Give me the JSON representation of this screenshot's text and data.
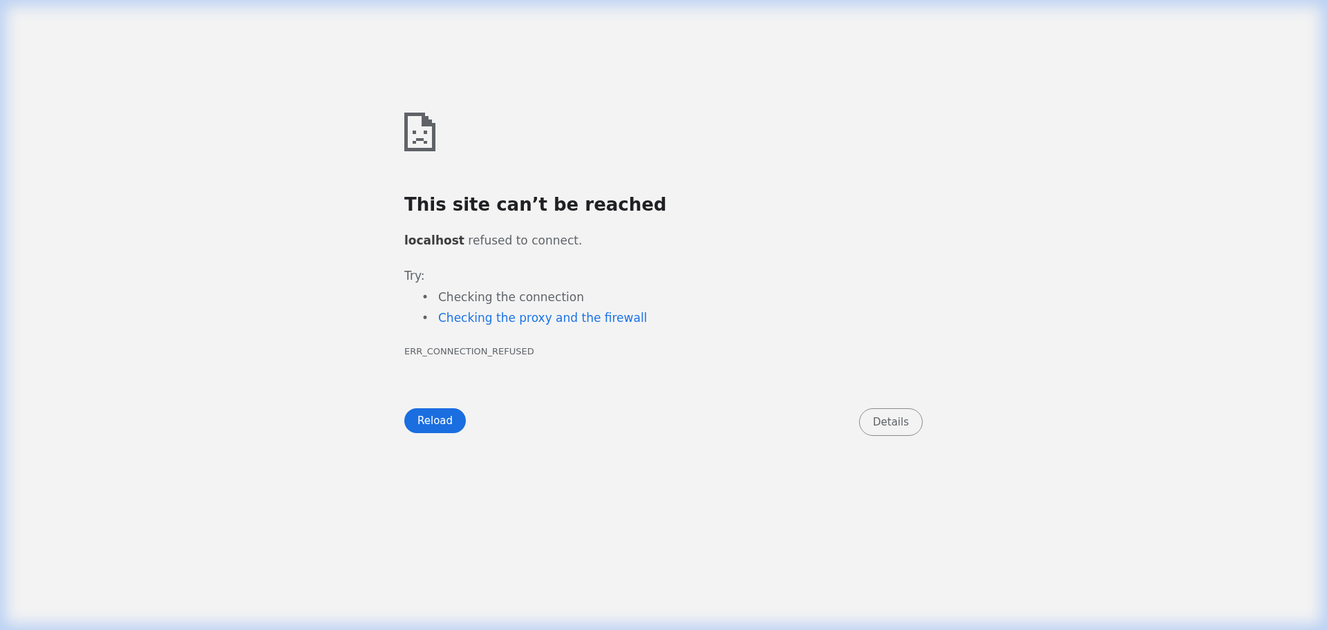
{
  "error_page": {
    "title": "This site can’t be reached",
    "message": "**localhost** refused to connect.",
    "try_label": "Try:",
    "suggestions": [
      {
        "bullet": "•",
        "text": "Checking the connection",
        "kind": "text"
      },
      {
        "bullet": "•",
        "text": "Checking the proxy and the firewall",
        "kind": "link"
      }
    ],
    "error_code": "ERR_CONNECTION_REFUSED",
    "buttons": [
      {
        "label": "Reload",
        "kind": "primary"
      },
      {
        "label": "Details",
        "kind": "secondary"
      }
    ]
  }
}
